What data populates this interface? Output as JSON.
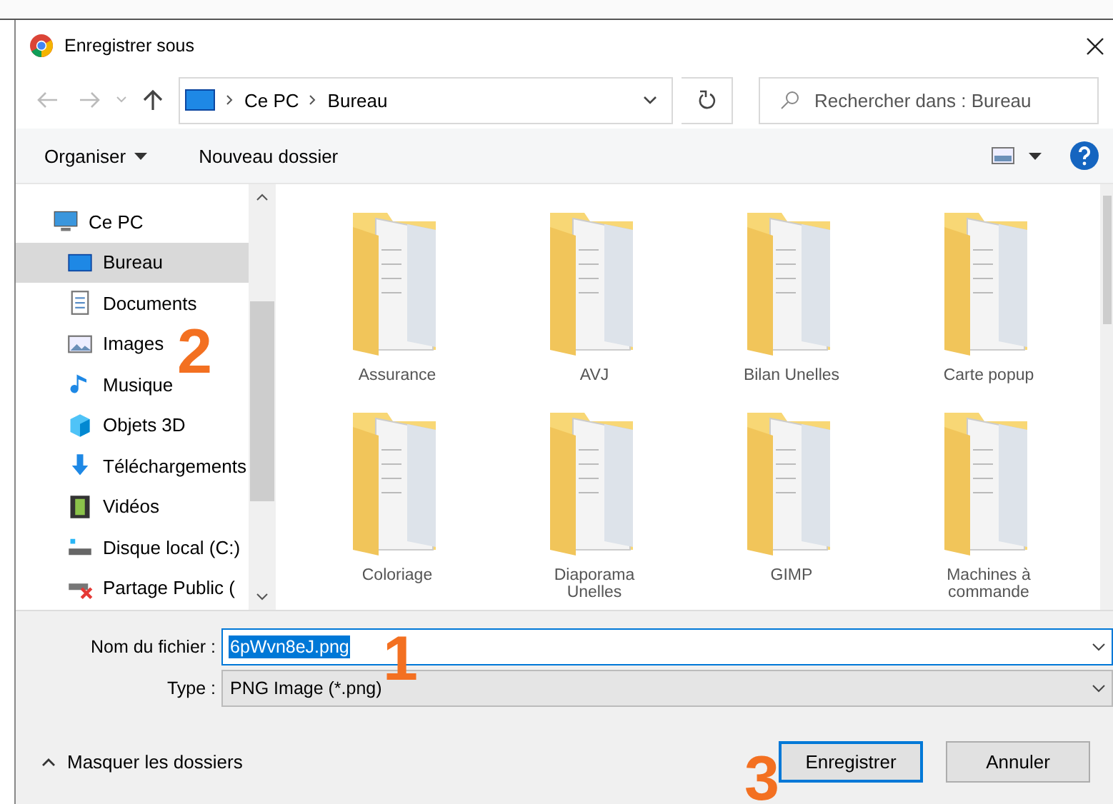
{
  "window": {
    "title": "Enregistrer sous"
  },
  "nav": {
    "path": [
      "Ce PC",
      "Bureau"
    ],
    "search": {
      "placeholder": "Rechercher dans : Bureau"
    }
  },
  "toolbar": {
    "organize": "Organiser",
    "new_folder": "Nouveau dossier"
  },
  "sidebar": {
    "items": [
      {
        "label": "Ce PC",
        "kind": "pc",
        "selected": false,
        "children": [
          {
            "label": "Bureau",
            "kind": "desktop",
            "selected": true
          },
          {
            "label": "Documents",
            "kind": "documents",
            "selected": false
          },
          {
            "label": "Images",
            "kind": "images",
            "selected": false
          },
          {
            "label": "Musique",
            "kind": "music",
            "selected": false
          },
          {
            "label": "Objets 3D",
            "kind": "objects",
            "selected": false
          },
          {
            "label": "Téléchargements",
            "kind": "downloads",
            "selected": false
          },
          {
            "label": "Vidéos",
            "kind": "videos",
            "selected": false
          },
          {
            "label": "Disque local (C:)",
            "kind": "drive",
            "selected": false
          },
          {
            "label": "Partage Public (",
            "kind": "netdrive",
            "selected": false
          }
        ]
      }
    ]
  },
  "folders": [
    {
      "name": "Assurance"
    },
    {
      "name": "AVJ"
    },
    {
      "name": "Bilan Unelles"
    },
    {
      "name": "Carte popup"
    },
    {
      "name": "Coloriage"
    },
    {
      "name": "Diaporama Unelles"
    },
    {
      "name": "GIMP"
    },
    {
      "name": "Machines à commande"
    }
  ],
  "form": {
    "filename_label": "Nom du fichier :",
    "filename": "6pWvn8eJ.png",
    "filename_selected": true,
    "type_label": "Type :",
    "type": "PNG Image (*.png)"
  },
  "footer": {
    "toggle": "Masquer les dossiers",
    "buttons": [
      {
        "label": "Enregistrer",
        "default": true
      },
      {
        "label": "Annuler",
        "default": false
      }
    ]
  },
  "annotations": [
    {
      "label": "1"
    },
    {
      "label": "2"
    },
    {
      "label": "3"
    }
  ]
}
